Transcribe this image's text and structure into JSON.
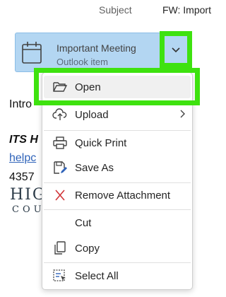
{
  "header": {
    "subject_label": "Subject",
    "subject_value": "FW: Import"
  },
  "attachment": {
    "name": "Important Meeting",
    "type": "Outlook item",
    "icon": "calendar-icon"
  },
  "background_text": {
    "intro": "Intro",
    "its": "ITS H",
    "help": "helpc",
    "phone": "4357",
    "logo_top": "HIG",
    "logo_bottom": "COU"
  },
  "menu": {
    "items": [
      {
        "label": "Open",
        "icon": "folder-open-icon"
      },
      {
        "label": "Upload",
        "icon": "cloud-upload-icon"
      },
      {
        "label": "Quick Print",
        "icon": "printer-icon"
      },
      {
        "label": "Save As",
        "icon": "save-as-icon"
      },
      {
        "label": "Remove Attachment",
        "icon": "remove-x-icon"
      },
      {
        "label": "Cut",
        "icon": ""
      },
      {
        "label": "Copy",
        "icon": "copy-icon"
      },
      {
        "label": "Select All",
        "icon": "select-all-icon"
      }
    ]
  },
  "colors": {
    "highlight": "#3ee20f",
    "attachment_bg": "#b3d6f2",
    "remove_icon": "#d13438",
    "accent_blue": "#2f63b9"
  }
}
